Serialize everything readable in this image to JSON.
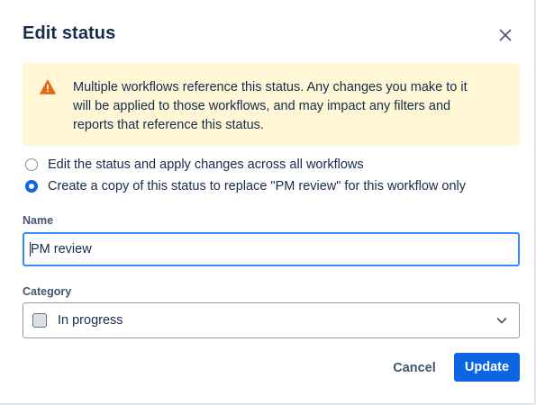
{
  "dialog": {
    "title": "Edit status",
    "close_icon": "close-icon"
  },
  "warning": {
    "icon": "warning-icon",
    "color": "#e56910",
    "background": "#fff7d6",
    "lines": [
      "Multiple workflows reference this status. Any changes you make to it",
      "will be applied to those workflows, and may impact any filters and",
      "reports that reference this status."
    ]
  },
  "options": [
    {
      "label": "Edit the status and apply changes across all workflows",
      "selected": false
    },
    {
      "label": "Create a copy of this status to replace \"PM review\" for this workflow only",
      "selected": true
    }
  ],
  "name_field": {
    "label": "Name",
    "value": "PM review"
  },
  "category_field": {
    "label": "Category",
    "value": "In progress",
    "icon": "chevron-down-icon"
  },
  "actions": {
    "cancel_label": "Cancel",
    "update_label": "Update",
    "primary_color": "#0c66e4"
  }
}
